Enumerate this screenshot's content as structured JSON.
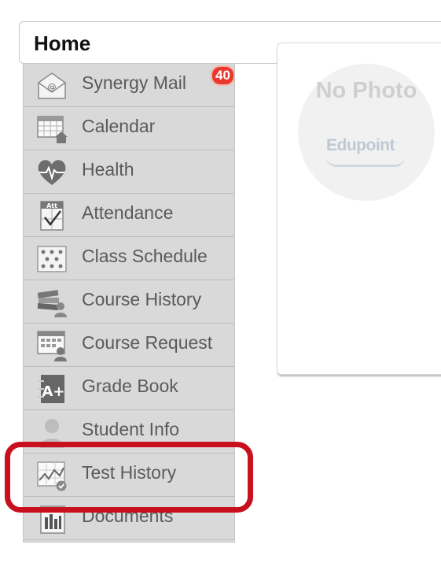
{
  "header": {
    "title": "Home"
  },
  "nav": {
    "items": [
      {
        "label": "Synergy Mail",
        "icon": "mail-icon",
        "badge": "40"
      },
      {
        "label": "Calendar",
        "icon": "calendar-icon"
      },
      {
        "label": "Health",
        "icon": "heart-icon"
      },
      {
        "label": "Attendance",
        "icon": "attendance-icon",
        "icon_text": "Att"
      },
      {
        "label": "Class Schedule",
        "icon": "class-schedule-icon"
      },
      {
        "label": "Course History",
        "icon": "course-history-icon"
      },
      {
        "label": "Course Request",
        "icon": "course-request-icon"
      },
      {
        "label": "Grade Book",
        "icon": "grade-book-icon",
        "icon_text": "A+"
      },
      {
        "label": "Student Info",
        "icon": "student-info-icon"
      },
      {
        "label": "Test History",
        "icon": "test-history-icon",
        "highlighted": true
      },
      {
        "label": "Documents",
        "icon": "documents-icon"
      }
    ]
  },
  "photo": {
    "placeholder_text": "No Photo",
    "brand": "Edupoint"
  },
  "colors": {
    "highlight": "#c8101e",
    "badge": "#e8392c",
    "nav_bg": "#d9d9d9"
  }
}
